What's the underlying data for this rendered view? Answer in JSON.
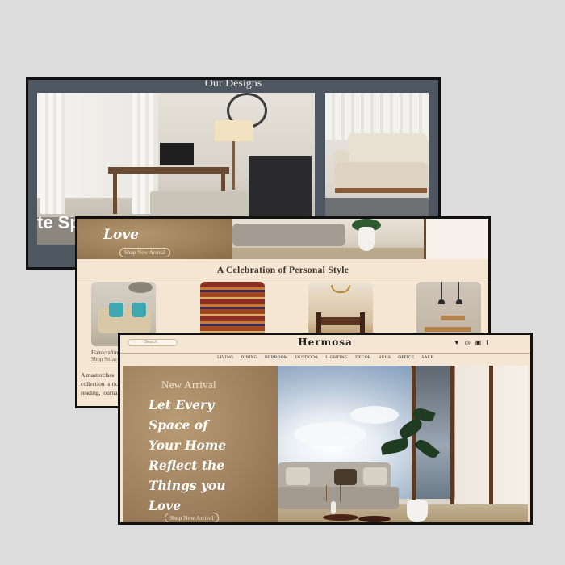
{
  "designs_card": {
    "title": "Our Designs",
    "overlay_text": "te Sp"
  },
  "middle_card": {
    "hero_partial_line": "Let Every Space of Your Home Reflect the Things you",
    "hero_last_line": "Love",
    "hero_button": "Shop New Arrival",
    "section_title": "A Celebration of Personal Style",
    "first_item": {
      "caption": "Handcrafting",
      "link": "Shop Sofas"
    },
    "paragraph_lines": [
      "A masterclass",
      "collection is ric",
      "reading, journa"
    ]
  },
  "front_card": {
    "search_placeholder": "Search",
    "brand": "Hermosa",
    "icons": [
      "location-icon",
      "pinterest-icon",
      "instagram-icon",
      "facebook-icon"
    ],
    "menu": [
      "LIVING",
      "DINING",
      "BEDROOM",
      "OUTDOOR",
      "LIGHTING",
      "DECOR",
      "RUGS",
      "OFFICE",
      "SALE"
    ],
    "eyebrow": "New Arrival",
    "headline_lines": [
      "Let Every",
      "Space of",
      "Your Home",
      "Reflect the",
      "Things you",
      "Love"
    ],
    "button": "Shop New Arrival"
  },
  "colors": {
    "background": "#dcdcdc",
    "designs_bg": "#4d5661",
    "cream": "#f5e6d3",
    "paper": "#a18260",
    "border": "#111111"
  }
}
